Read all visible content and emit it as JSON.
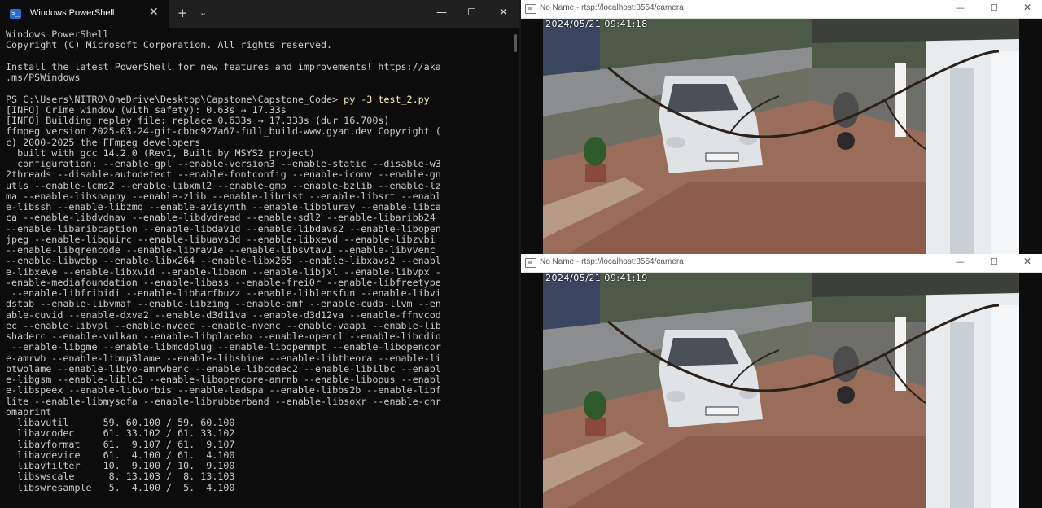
{
  "terminal": {
    "tab_title": "Windows PowerShell",
    "tab_icon": "powershell-icon",
    "new_tab": "+",
    "dropdown": "⌄",
    "controls": {
      "minimize": "—",
      "maximize": "☐",
      "close": "✕"
    },
    "lines_before_cmd": [
      "Windows PowerShell",
      "Copyright (C) Microsoft Corporation. All rights reserved.",
      "",
      "Install the latest PowerShell for new features and improvements! https://aka",
      ".ms/PSWindows",
      ""
    ],
    "prompt": "PS C:\\Users\\NITRO\\OneDrive\\Desktop\\Capstone\\Capstone_Code> ",
    "command": "py -3 test_2.py",
    "output_lines": [
      "[INFO] Crime window (with safety): 0.63s → 17.33s",
      "[INFO] Building replay file: replace 0.633s → 17.333s (dur 16.700s)",
      "ffmpeg version 2025-03-24-git-cbbc927a67-full_build-www.gyan.dev Copyright (",
      "c) 2000-2025 the FFmpeg developers",
      "  built with gcc 14.2.0 (Rev1, Built by MSYS2 project)",
      "  configuration: --enable-gpl --enable-version3 --enable-static --disable-w3",
      "2threads --disable-autodetect --enable-fontconfig --enable-iconv --enable-gn",
      "utls --enable-lcms2 --enable-libxml2 --enable-gmp --enable-bzlib --enable-lz",
      "ma --enable-libsnappy --enable-zlib --enable-librist --enable-libsrt --enabl",
      "e-libssh --enable-libzmq --enable-avisynth --enable-libbluray --enable-libca",
      "ca --enable-libdvdnav --enable-libdvdread --enable-sdl2 --enable-libaribb24",
      "--enable-libaribcaption --enable-libdav1d --enable-libdavs2 --enable-libopen",
      "jpeg --enable-libquirc --enable-libuavs3d --enable-libxevd --enable-libzvbi",
      "--enable-libqrencode --enable-librav1e --enable-libsvtav1 --enable-libvvenc",
      "--enable-libwebp --enable-libx264 --enable-libx265 --enable-libxavs2 --enabl",
      "e-libxeve --enable-libxvid --enable-libaom --enable-libjxl --enable-libvpx -",
      "-enable-mediafoundation --enable-libass --enable-frei0r --enable-libfreetype",
      " --enable-libfribidi --enable-libharfbuzz --enable-liblensfun --enable-libvi",
      "dstab --enable-libvmaf --enable-libzimg --enable-amf --enable-cuda-llvm --en",
      "able-cuvid --enable-dxva2 --enable-d3d11va --enable-d3d12va --enable-ffnvcod",
      "ec --enable-libvpl --enable-nvdec --enable-nvenc --enable-vaapi --enable-lib",
      "shaderc --enable-vulkan --enable-libplacebo --enable-opencl --enable-libcdio",
      " --enable-libgme --enable-libmodplug --enable-libopenmpt --enable-libopencor",
      "e-amrwb --enable-libmp3lame --enable-libshine --enable-libtheora --enable-li",
      "btwolame --enable-libvo-amrwbenc --enable-libcodec2 --enable-libilbc --enabl",
      "e-libgsm --enable-liblc3 --enable-libopencore-amrnb --enable-libopus --enabl",
      "e-libspeex --enable-libvorbis --enable-ladspa --enable-libbs2b --enable-libf",
      "lite --enable-libmysofa --enable-librubberband --enable-libsoxr --enable-chr",
      "omaprint",
      "  libavutil      59. 60.100 / 59. 60.100",
      "  libavcodec     61. 33.102 / 61. 33.102",
      "  libavformat    61.  9.107 / 61.  9.107",
      "  libavdevice    61.  4.100 / 61.  4.100",
      "  libavfilter    10.  9.100 / 10.  9.100",
      "  libswscale      8. 13.103 /  8. 13.103",
      "  libswresample   5.  4.100 /  5.  4.100"
    ]
  },
  "cameras": [
    {
      "title": "No Name - rtsp://localhost:8554/camera",
      "timestamp": "2024/05/21  09:41:18"
    },
    {
      "title": "No Name - rtsp://localhost:8554/camera",
      "timestamp": "2024/05/21  09:41:19"
    }
  ],
  "camera_controls": {
    "minimize": "—",
    "maximize": "☐",
    "close": "✕"
  },
  "colors": {
    "terminal_bg": "#0c0c0c",
    "terminal_text": "#cccccc",
    "command": "#f9f1a5",
    "titlebar": "#1f1f1f"
  }
}
